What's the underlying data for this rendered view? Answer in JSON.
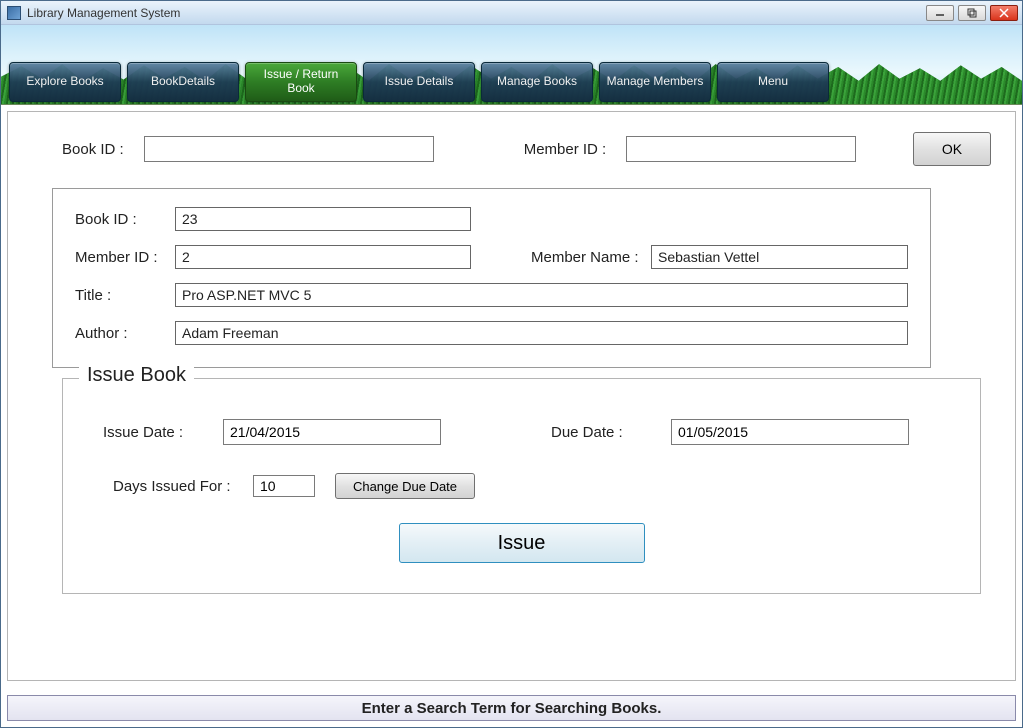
{
  "window": {
    "title": "Library Management System"
  },
  "tabs": [
    {
      "label": "Explore Books",
      "active": false
    },
    {
      "label": "BookDetails",
      "active": false
    },
    {
      "label": "Issue / Return Book",
      "active": true
    },
    {
      "label": "Issue Details",
      "active": false
    },
    {
      "label": "Manage Books",
      "active": false
    },
    {
      "label": "Manage Members",
      "active": false
    },
    {
      "label": "Menu",
      "active": false
    }
  ],
  "topForm": {
    "book_id_label": "Book ID :",
    "book_id_value": "",
    "member_id_label": "Member ID :",
    "member_id_value": "",
    "ok_label": "OK"
  },
  "details": {
    "book_id_label": "Book ID :",
    "book_id_value": "23",
    "member_id_label": "Member ID :",
    "member_id_value": "2",
    "member_name_label": "Member Name :",
    "member_name_value": "Sebastian Vettel",
    "title_label": "Title :",
    "title_value": "Pro ASP.NET MVC 5",
    "author_label": "Author :",
    "author_value": "Adam Freeman"
  },
  "issue": {
    "legend": "Issue Book",
    "issue_date_label": "Issue Date :",
    "issue_date_value": "21/04/2015",
    "due_date_label": "Due Date :",
    "due_date_value": "01/05/2015",
    "days_label": "Days Issued For :",
    "days_value": "10",
    "change_due_label": "Change Due Date",
    "issue_button_label": "Issue"
  },
  "status": {
    "text": "Enter a Search Term for Searching Books."
  }
}
